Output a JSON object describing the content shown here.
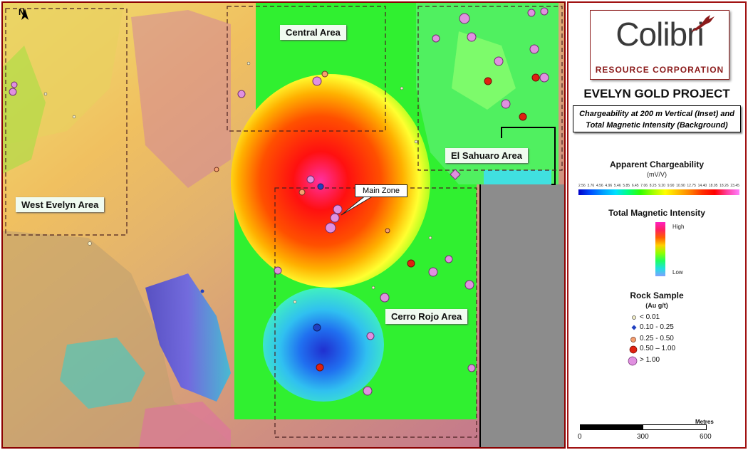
{
  "map": {
    "north_label": "N",
    "areas": [
      {
        "id": "central",
        "label": "Central Area"
      },
      {
        "id": "west",
        "label": "West Evelyn Area"
      },
      {
        "id": "sahuaro",
        "label": "El Sahuaro Area"
      },
      {
        "id": "cerro",
        "label": "Cerro Rojo Area"
      }
    ],
    "callout": "Main Zone"
  },
  "legend": {
    "logo_main": "Colibri",
    "logo_sub": "RESOURCE CORPORATION",
    "project_title": "EVELYN GOLD PROJECT",
    "subtitle_line1": "Chargeability at 200 m Vertical (Inset) and",
    "subtitle_line2": "Total Magnetic Intensity (Background)",
    "chargeability": {
      "title": "Apparent Chargeability",
      "unit": "(mV/V)",
      "ticks": [
        "2.56",
        "3.76",
        "4.56",
        "4.96",
        "5.46",
        "5.85",
        "6.45",
        "7.06",
        "8.25",
        "9.20",
        "9.90",
        "10.90",
        "12.75",
        "14.40",
        "18.05",
        "18.26",
        "23.45"
      ]
    },
    "magnetic": {
      "title": "Total Magnetic Intensity",
      "high": "High",
      "low": "Low"
    },
    "rock_sample": {
      "title": "Rock Sample",
      "unit": "(Au g/t)",
      "items": [
        {
          "label": "< 0.01",
          "color": "#f5f0c8"
        },
        {
          "label": "0.10 - 0.25",
          "color": "#2040c0"
        },
        {
          "label": "0.25 - 0.50",
          "color": "#f4a070"
        },
        {
          "label": "0.50 – 1.00",
          "color": "#e02010"
        },
        {
          "label": "> 1.00",
          "color": "#e090e0"
        }
      ]
    },
    "scale": {
      "unit": "Metres",
      "labels": [
        "0",
        "300",
        "600"
      ]
    }
  },
  "colors": {
    "frame": "#8b0000",
    "area_label_bg": "#f0fbf0"
  }
}
